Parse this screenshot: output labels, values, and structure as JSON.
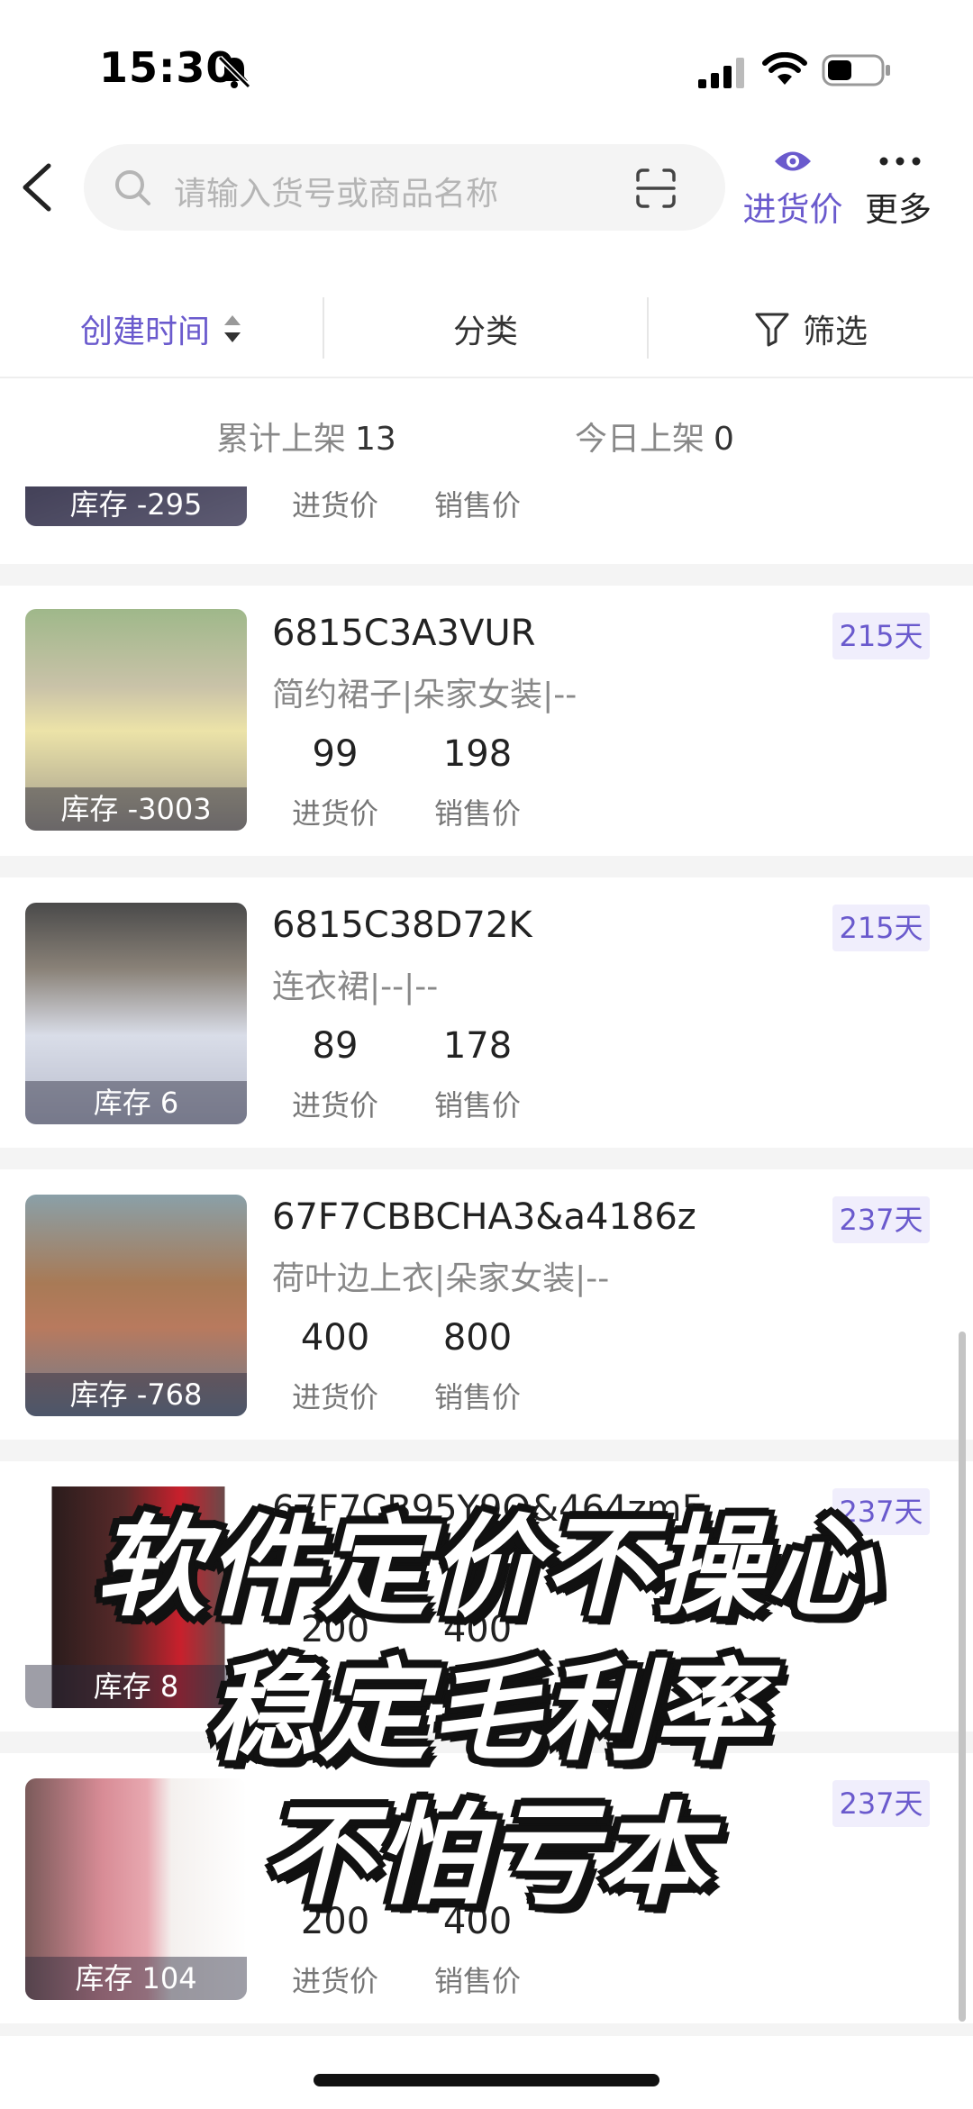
{
  "status_bar": {
    "time": "15:30"
  },
  "search": {
    "placeholder": "请输入货号或商品名称"
  },
  "header": {
    "purchase_price_label": "进货价",
    "more_label": "更多"
  },
  "filters": {
    "sort_label": "创建时间",
    "category_label": "分类",
    "filter_label": "筛选"
  },
  "stats": {
    "total_label": "累计上架",
    "total_value": "13",
    "today_label": "今日上架",
    "today_value": "0"
  },
  "labels": {
    "purchase": "进货价",
    "sale": "销售价"
  },
  "products": [
    {
      "sku": "",
      "category": "",
      "stock": "库存 -295",
      "purchase_price": "",
      "sale_price": "",
      "days": ""
    },
    {
      "sku": "6815C3A3VUR",
      "category": "简约裙子|朵家女装|--",
      "stock": "库存 -3003",
      "purchase_price": "99",
      "sale_price": "198",
      "days": "215天"
    },
    {
      "sku": "6815C38D72K",
      "category": "连衣裙|--|--",
      "stock": "库存 6",
      "purchase_price": "89",
      "sale_price": "178",
      "days": "215天"
    },
    {
      "sku": "67F7CBBCHA3&a4186z",
      "category": "荷叶边上衣|朵家女装|--",
      "stock": "库存 -768",
      "purchase_price": "400",
      "sale_price": "800",
      "days": "237天"
    },
    {
      "sku": "67F7CB95Y9O&464zm5",
      "category": "",
      "stock": "库存 8",
      "purchase_price": "200",
      "sale_price": "400",
      "days": "237天"
    },
    {
      "sku": "",
      "category": "",
      "stock": "库存 104",
      "purchase_price": "200",
      "sale_price": "400",
      "days": "237天"
    }
  ],
  "overlay": {
    "line1": "软件定价不操心",
    "line2": "稳定毛利率",
    "line3": "不怕亏本"
  },
  "colors": {
    "accent": "#6a5acd",
    "badge_bg": "#f0eefc",
    "separator": "#f4f4f4"
  },
  "icons": [
    "bell-slash-icon",
    "signal-icon",
    "wifi-icon",
    "battery-icon",
    "back-icon",
    "search-icon",
    "scan-icon",
    "eye-icon",
    "more-icon",
    "sort-icon",
    "funnel-icon"
  ]
}
